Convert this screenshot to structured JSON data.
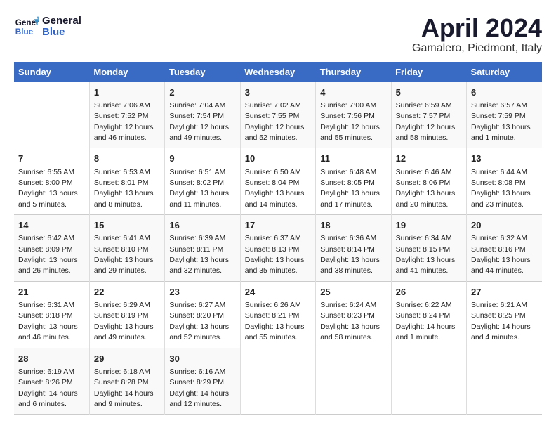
{
  "header": {
    "logo_line1": "General",
    "logo_line2": "Blue",
    "title": "April 2024",
    "subtitle": "Gamalero, Piedmont, Italy"
  },
  "columns": [
    "Sunday",
    "Monday",
    "Tuesday",
    "Wednesday",
    "Thursday",
    "Friday",
    "Saturday"
  ],
  "weeks": [
    [
      {
        "day": "",
        "info": ""
      },
      {
        "day": "1",
        "info": "Sunrise: 7:06 AM\nSunset: 7:52 PM\nDaylight: 12 hours\nand 46 minutes."
      },
      {
        "day": "2",
        "info": "Sunrise: 7:04 AM\nSunset: 7:54 PM\nDaylight: 12 hours\nand 49 minutes."
      },
      {
        "day": "3",
        "info": "Sunrise: 7:02 AM\nSunset: 7:55 PM\nDaylight: 12 hours\nand 52 minutes."
      },
      {
        "day": "4",
        "info": "Sunrise: 7:00 AM\nSunset: 7:56 PM\nDaylight: 12 hours\nand 55 minutes."
      },
      {
        "day": "5",
        "info": "Sunrise: 6:59 AM\nSunset: 7:57 PM\nDaylight: 12 hours\nand 58 minutes."
      },
      {
        "day": "6",
        "info": "Sunrise: 6:57 AM\nSunset: 7:59 PM\nDaylight: 13 hours\nand 1 minute."
      }
    ],
    [
      {
        "day": "7",
        "info": "Sunrise: 6:55 AM\nSunset: 8:00 PM\nDaylight: 13 hours\nand 5 minutes."
      },
      {
        "day": "8",
        "info": "Sunrise: 6:53 AM\nSunset: 8:01 PM\nDaylight: 13 hours\nand 8 minutes."
      },
      {
        "day": "9",
        "info": "Sunrise: 6:51 AM\nSunset: 8:02 PM\nDaylight: 13 hours\nand 11 minutes."
      },
      {
        "day": "10",
        "info": "Sunrise: 6:50 AM\nSunset: 8:04 PM\nDaylight: 13 hours\nand 14 minutes."
      },
      {
        "day": "11",
        "info": "Sunrise: 6:48 AM\nSunset: 8:05 PM\nDaylight: 13 hours\nand 17 minutes."
      },
      {
        "day": "12",
        "info": "Sunrise: 6:46 AM\nSunset: 8:06 PM\nDaylight: 13 hours\nand 20 minutes."
      },
      {
        "day": "13",
        "info": "Sunrise: 6:44 AM\nSunset: 8:08 PM\nDaylight: 13 hours\nand 23 minutes."
      }
    ],
    [
      {
        "day": "14",
        "info": "Sunrise: 6:42 AM\nSunset: 8:09 PM\nDaylight: 13 hours\nand 26 minutes."
      },
      {
        "day": "15",
        "info": "Sunrise: 6:41 AM\nSunset: 8:10 PM\nDaylight: 13 hours\nand 29 minutes."
      },
      {
        "day": "16",
        "info": "Sunrise: 6:39 AM\nSunset: 8:11 PM\nDaylight: 13 hours\nand 32 minutes."
      },
      {
        "day": "17",
        "info": "Sunrise: 6:37 AM\nSunset: 8:13 PM\nDaylight: 13 hours\nand 35 minutes."
      },
      {
        "day": "18",
        "info": "Sunrise: 6:36 AM\nSunset: 8:14 PM\nDaylight: 13 hours\nand 38 minutes."
      },
      {
        "day": "19",
        "info": "Sunrise: 6:34 AM\nSunset: 8:15 PM\nDaylight: 13 hours\nand 41 minutes."
      },
      {
        "day": "20",
        "info": "Sunrise: 6:32 AM\nSunset: 8:16 PM\nDaylight: 13 hours\nand 44 minutes."
      }
    ],
    [
      {
        "day": "21",
        "info": "Sunrise: 6:31 AM\nSunset: 8:18 PM\nDaylight: 13 hours\nand 46 minutes."
      },
      {
        "day": "22",
        "info": "Sunrise: 6:29 AM\nSunset: 8:19 PM\nDaylight: 13 hours\nand 49 minutes."
      },
      {
        "day": "23",
        "info": "Sunrise: 6:27 AM\nSunset: 8:20 PM\nDaylight: 13 hours\nand 52 minutes."
      },
      {
        "day": "24",
        "info": "Sunrise: 6:26 AM\nSunset: 8:21 PM\nDaylight: 13 hours\nand 55 minutes."
      },
      {
        "day": "25",
        "info": "Sunrise: 6:24 AM\nSunset: 8:23 PM\nDaylight: 13 hours\nand 58 minutes."
      },
      {
        "day": "26",
        "info": "Sunrise: 6:22 AM\nSunset: 8:24 PM\nDaylight: 14 hours\nand 1 minute."
      },
      {
        "day": "27",
        "info": "Sunrise: 6:21 AM\nSunset: 8:25 PM\nDaylight: 14 hours\nand 4 minutes."
      }
    ],
    [
      {
        "day": "28",
        "info": "Sunrise: 6:19 AM\nSunset: 8:26 PM\nDaylight: 14 hours\nand 6 minutes."
      },
      {
        "day": "29",
        "info": "Sunrise: 6:18 AM\nSunset: 8:28 PM\nDaylight: 14 hours\nand 9 minutes."
      },
      {
        "day": "30",
        "info": "Sunrise: 6:16 AM\nSunset: 8:29 PM\nDaylight: 14 hours\nand 12 minutes."
      },
      {
        "day": "",
        "info": ""
      },
      {
        "day": "",
        "info": ""
      },
      {
        "day": "",
        "info": ""
      },
      {
        "day": "",
        "info": ""
      }
    ]
  ]
}
